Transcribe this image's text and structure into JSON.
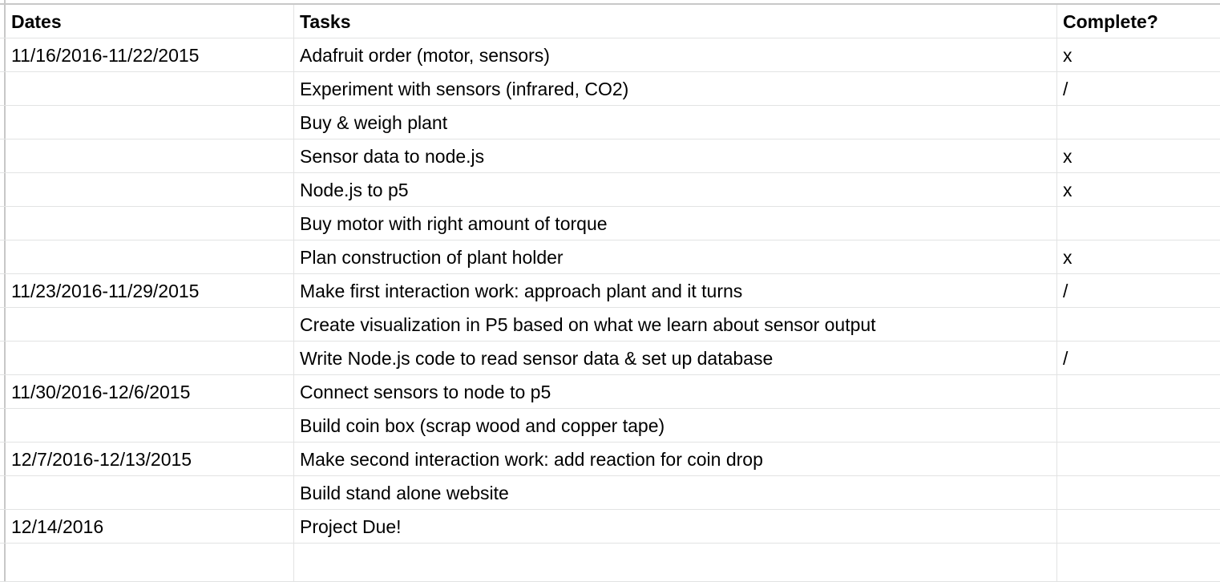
{
  "header": {
    "dates": "Dates",
    "tasks": "Tasks",
    "complete": "Complete?"
  },
  "rows": [
    {
      "date": "11/16/2016-11/22/2015",
      "task": "Adafruit order (motor, sensors)",
      "complete": "x"
    },
    {
      "date": "",
      "task": "Experiment with sensors (infrared, CO2)",
      "complete": "/"
    },
    {
      "date": "",
      "task": "Buy & weigh plant",
      "complete": ""
    },
    {
      "date": "",
      "task": "Sensor data to node.js",
      "complete": "x"
    },
    {
      "date": "",
      "task": "Node.js to p5",
      "complete": "x"
    },
    {
      "date": "",
      "task": "Buy motor with right amount of torque",
      "complete": ""
    },
    {
      "date": "",
      "task": "Plan construction of plant holder",
      "complete": "x"
    },
    {
      "date": "11/23/2016-11/29/2015",
      "task": "Make first interaction work: approach plant and it turns",
      "complete": "/"
    },
    {
      "date": "",
      "task": "Create visualization in P5 based on what we learn about sensor output",
      "complete": ""
    },
    {
      "date": "",
      "task": "Write Node.js code to read sensor data & set up database",
      "complete": "/"
    },
    {
      "date": "11/30/2016-12/6/2015",
      "task": "Connect sensors to node to p5",
      "complete": ""
    },
    {
      "date": "",
      "task": "Build coin box (scrap wood and copper tape)",
      "complete": ""
    },
    {
      "date": "12/7/2016-12/13/2015",
      "task": "Make second interaction work: add reaction for coin drop",
      "complete": ""
    },
    {
      "date": "",
      "task": "Build stand alone website",
      "complete": ""
    },
    {
      "date": "12/14/2016",
      "task": "Project Due!",
      "complete": ""
    },
    {
      "date": "",
      "task": "",
      "complete": ""
    }
  ]
}
